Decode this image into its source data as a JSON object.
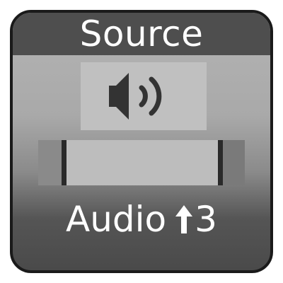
{
  "tile": {
    "title": "Source",
    "label": "Audio",
    "number": "3",
    "icons": {
      "speaker": "speaker-volume-icon",
      "arrow": "arrow-up-icon"
    }
  },
  "colors": {
    "header_bg": "#4e4e4e",
    "border": "#1a1a1a",
    "text": "#ffffff",
    "icon": "#333333"
  }
}
